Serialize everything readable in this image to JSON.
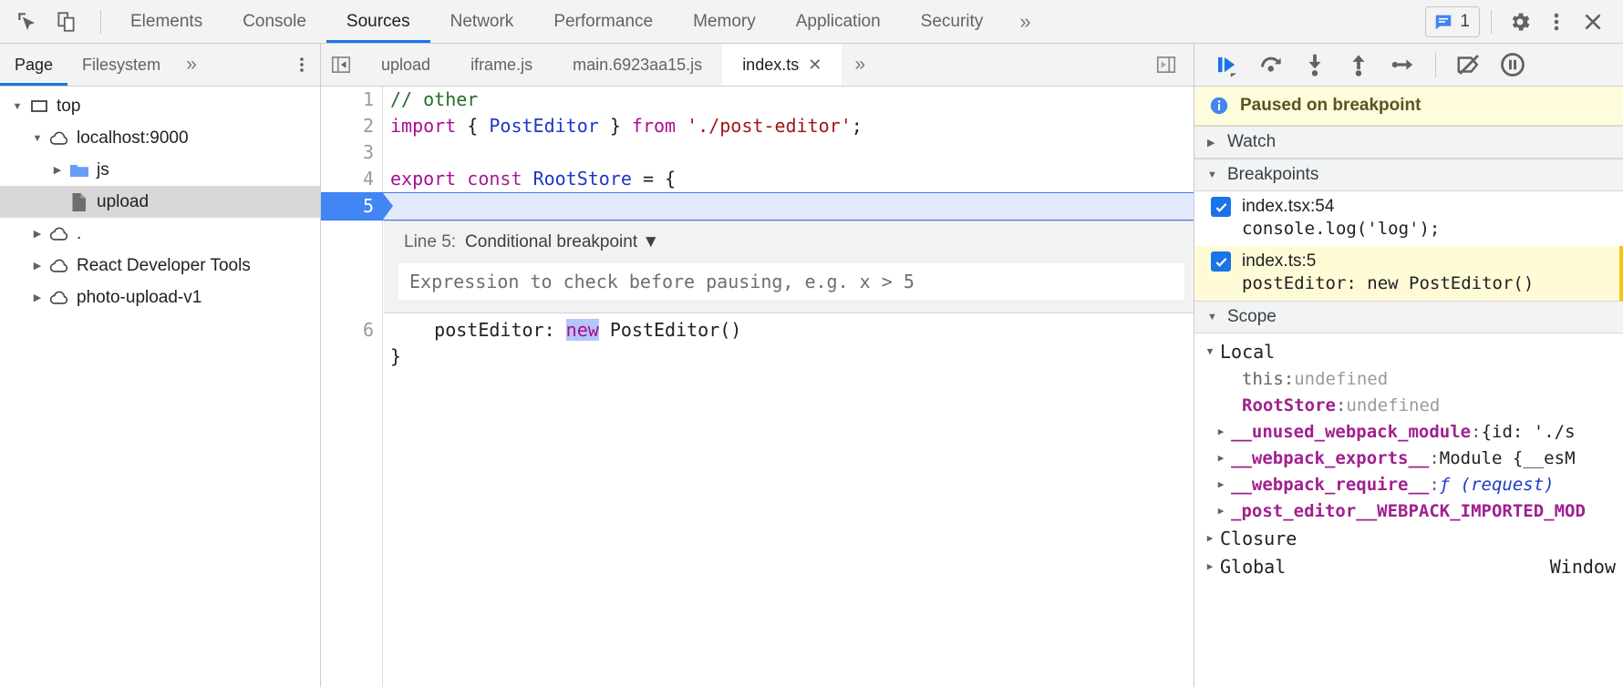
{
  "toolbar": {
    "inspect_icon": "cursor-inspect-icon",
    "device_icon": "device-toggle-icon",
    "tabs": [
      {
        "label": "Elements",
        "selected": false
      },
      {
        "label": "Console",
        "selected": false
      },
      {
        "label": "Sources",
        "selected": true
      },
      {
        "label": "Network",
        "selected": false
      },
      {
        "label": "Performance",
        "selected": false
      },
      {
        "label": "Memory",
        "selected": false
      },
      {
        "label": "Application",
        "selected": false
      },
      {
        "label": "Security",
        "selected": false
      }
    ],
    "more_tabs_label": "»",
    "message_count": "1",
    "message_icon": "message-bubble-icon",
    "settings_icon": "gear-icon",
    "kebab_icon": "more-vertical-icon",
    "close_icon": "close-icon"
  },
  "navigator_toolbar": {
    "tabs": [
      {
        "label": "Page",
        "selected": true
      },
      {
        "label": "Filesystem",
        "selected": false
      }
    ],
    "more_label": "»",
    "kebab_icon": "more-vertical-icon"
  },
  "sources_toolbar": {
    "panel_toggle_icon": "show-navigator-icon",
    "file_tabs": [
      {
        "label": "upload",
        "selected": false,
        "closable": false
      },
      {
        "label": "iframe.js",
        "selected": false,
        "closable": false
      },
      {
        "label": "main.6923aa15.js",
        "selected": false,
        "closable": false
      },
      {
        "label": "index.ts",
        "selected": true,
        "closable": true,
        "close_glyph": "✕"
      }
    ],
    "more_label": "»",
    "right_toggle_icon": "show-debugger-icon"
  },
  "debug_controls": [
    {
      "name": "resume-script-execution",
      "icon": "resume-icon",
      "active": true
    },
    {
      "name": "step-over-next-function-call",
      "icon": "step-over-icon",
      "active": false
    },
    {
      "name": "step-into-next-function-call",
      "icon": "step-into-icon",
      "active": false
    },
    {
      "name": "step-out-of-current-function",
      "icon": "step-out-icon",
      "active": false
    },
    {
      "name": "step",
      "icon": "step-icon",
      "active": false
    },
    {
      "name": "deactivate-breakpoints",
      "icon": "deactivate-breakpoints-icon",
      "active": false
    },
    {
      "name": "pause-on-exceptions",
      "icon": "pause-icon",
      "active": false
    }
  ],
  "navigator_tree": [
    {
      "label": "top",
      "indent": 0,
      "twisty": "down",
      "icon": "frame-icon"
    },
    {
      "label": "localhost:9000",
      "indent": 1,
      "twisty": "down",
      "icon": "cloud-icon"
    },
    {
      "label": "js",
      "indent": 2,
      "twisty": "right",
      "icon": "folder-icon"
    },
    {
      "label": "upload",
      "indent": 2,
      "twisty": "none",
      "icon": "file-icon",
      "selected": true
    },
    {
      "label": ".",
      "indent": 1,
      "twisty": "right",
      "icon": "cloud-icon"
    },
    {
      "label": "React Developer Tools",
      "indent": 1,
      "twisty": "right",
      "icon": "cloud-icon"
    },
    {
      "label": "photo-upload-v1",
      "indent": 1,
      "twisty": "right",
      "icon": "cloud-icon"
    }
  ],
  "editor": {
    "lines": [
      {
        "num": "1",
        "tokens": [
          {
            "t": "// other",
            "c": "tk-comment"
          }
        ]
      },
      {
        "num": "2",
        "tokens": [
          {
            "t": "import",
            "c": "tk-keyword"
          },
          {
            "t": " { ",
            "c": "tk-plain"
          },
          {
            "t": "PostEditor",
            "c": "tk-type"
          },
          {
            "t": " } ",
            "c": "tk-plain"
          },
          {
            "t": "from",
            "c": "tk-keyword"
          },
          {
            "t": " ",
            "c": "tk-plain"
          },
          {
            "t": "'./post-editor'",
            "c": "tk-string"
          },
          {
            "t": ";",
            "c": "tk-plain"
          }
        ]
      },
      {
        "num": "3",
        "tokens": []
      },
      {
        "num": "4",
        "tokens": [
          {
            "t": "export",
            "c": "tk-keyword"
          },
          {
            "t": " ",
            "c": "tk-plain"
          },
          {
            "t": "const",
            "c": "tk-var"
          },
          {
            "t": " ",
            "c": "tk-plain"
          },
          {
            "t": "RootStore",
            "c": "tk-type"
          },
          {
            "t": " = {",
            "c": "tk-plain"
          }
        ]
      },
      {
        "num": "5",
        "breakpoint": true,
        "tokens": []
      },
      {
        "num": "6",
        "tokens": [
          {
            "t": "}",
            "c": "tk-plain"
          }
        ]
      }
    ],
    "breakpoint_line_content": [
      {
        "t": "    postEditor: ",
        "c": "tk-plain"
      },
      {
        "t": "new",
        "c": "tk-new-sel"
      },
      {
        "t": " PostEditor()",
        "c": "tk-plain"
      }
    ],
    "conditional_breakpoint": {
      "line_label": "Line 5:",
      "type_label": "Conditional breakpoint",
      "dropdown_glyph": "▼",
      "input_value": "",
      "input_placeholder": "Expression to check before pausing, e.g. x > 5"
    }
  },
  "debugger_sidebar": {
    "paused_banner": {
      "icon": "info-icon",
      "text": "Paused on breakpoint"
    },
    "sections": {
      "watch": {
        "label": "Watch",
        "arrow": "▶",
        "expanded": false
      },
      "breakpoints": {
        "label": "Breakpoints",
        "arrow": "▼",
        "expanded": true
      },
      "scope": {
        "label": "Scope",
        "arrow": "▼",
        "expanded": true
      }
    },
    "breakpoints": [
      {
        "location": "index.tsx:54",
        "code": "console.log('log');",
        "checked": true,
        "active": false
      },
      {
        "location": "index.ts:5",
        "code": "postEditor: new PostEditor()",
        "checked": true,
        "active": true
      }
    ],
    "scope": {
      "local_label": "Local",
      "local_arrow": "▼",
      "entries": [
        {
          "twisty": "none",
          "name": "this",
          "name_style": "plainprop",
          "sep": ": ",
          "value": "undefined",
          "value_style": "sc-val"
        },
        {
          "twisty": "none",
          "name": "RootStore",
          "name_style": "prop",
          "sep": ": ",
          "value": "undefined",
          "value_style": "sc-val"
        },
        {
          "twisty": "right",
          "name": "__unused_webpack_module",
          "name_style": "prop",
          "sep": ": ",
          "value": "{id: './s",
          "value_style": "sc-val mod"
        },
        {
          "twisty": "right",
          "name": "__webpack_exports__",
          "name_style": "prop",
          "sep": ": ",
          "value": "Module {__esM",
          "value_style": "sc-val mod"
        },
        {
          "twisty": "right",
          "name": "__webpack_require__",
          "name_style": "prop",
          "sep": ": ",
          "value": "ƒ (request)",
          "value_style": "sc-val fn"
        },
        {
          "twisty": "right",
          "name": "_post_editor__WEBPACK_IMPORTED_MOD",
          "name_style": "prop",
          "sep": "",
          "value": "",
          "value_style": "sc-val"
        }
      ],
      "closure": {
        "label": "Closure",
        "arrow": "▶",
        "value": ""
      },
      "global": {
        "label": "Global",
        "arrow": "▶",
        "value": "Window"
      }
    }
  }
}
